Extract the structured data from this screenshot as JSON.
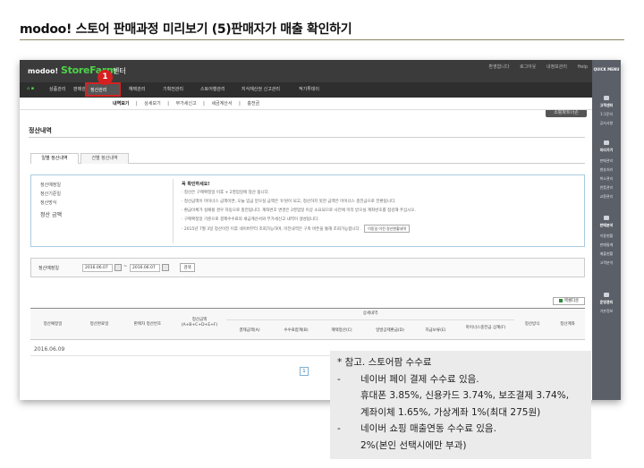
{
  "slide": {
    "title": "modoo! 스토어 판매과정 미리보기 (5)판매자가 매출 확인하기"
  },
  "header": {
    "modoo_logo": "modoo!",
    "store_logo": "StoreFarm",
    "center_label": "센터",
    "top_links": [
      "환영합니다 ",
      "로그아웃",
      "내정보관리",
      "Help"
    ]
  },
  "menu": {
    "items": [
      "상품관리",
      "판매관리",
      "정산관리",
      "혜택관리",
      "기획전관리",
      "스토어행관리",
      "지식재산권 신고관리",
      "적기투데이"
    ],
    "active": "정산관리",
    "right_button": "쇼핑파트너존",
    "badge": "1"
  },
  "submenu": {
    "items": [
      "내역보기",
      "상세보기",
      "부가세신고",
      "세금계산서",
      "충전금"
    ]
  },
  "right_panel": {
    "items": [
      "QUICK MENU",
      "고객센터",
      "1:1문의",
      "공지사항",
      "미리가기",
      "판매관리",
      "발송처리",
      "취소관리",
      "반품관리",
      "교환관리",
      "판매분석",
      "이용현황",
      "판매통계",
      "매출현황",
      "고객분석",
      "운영관리",
      "기본정보"
    ]
  },
  "page": {
    "heading": "정산내역",
    "tabs": [
      "일별 정산내역",
      "건별 정산내역"
    ],
    "active_tab": "일별 정산내역"
  },
  "info_box": {
    "labels": [
      "정산예정일",
      "정산기준일",
      "정산방식",
      "정산 금액"
    ],
    "lead": "꼭 확인하세요!",
    "notes": [
      "· 정산은 구매확정일 이후 + 2영업일에 정산 됩니다.",
      "· 정산금액이 마이너스 금액이면, 오늘 입금 받으실 금액은 '0'원이 되고, 정산하지 못한 금액은 마이너스 충전금으로 전환됩니다.",
      "· 환급이체가 실패될 경우 자동으로 충전됩니다. 계좌번호 변경은 2영업일 이상 소요되므로 사전에 미리 받으실 계좌번호를 점검해 주십시오.",
      "· 구매확정일 기준으로 결제수수료의 세금계산서와 부가세신고 내역이 생성됩니다.",
      "· 2015년 7월 3일 정산이전 이후 네이버부터 조회가능하며, 이전내역은 구축 버튼을 통해 조회가능합니다."
    ],
    "prev_button": "이동일 이전 정산현황내역"
  },
  "search": {
    "label": "정산예정일",
    "date_from": "2016.06.07",
    "date_to": "2016.06.07",
    "tilde": "~",
    "button": "검색"
  },
  "grid": {
    "excel_button": "엑셀다운",
    "group_header": "상세내역",
    "columns": [
      "정산예정일",
      "정산완료일",
      "판매자 정산번호",
      "정산금액\n(A+B+C+D+E+F)",
      "결제금액(A)",
      "수수료합계(B)",
      "혜택정산(C)",
      "일발공제환급(D)",
      "지급보류(E)",
      "마이너스충전금 상계(F)",
      "정산방식",
      "정산계좌"
    ],
    "rows": [
      {
        "date": "2016.06.09"
      }
    ],
    "page_number": "1"
  },
  "note": {
    "title": "* 참고. 스토어팜 수수료",
    "lines": [
      {
        "type": "bullet",
        "text": "네이버 페이 결제 수수료 있음."
      },
      {
        "type": "indent",
        "text": "휴대폰 3.85%, 신용카드 3.74%, 보조결제 3.74%,"
      },
      {
        "type": "indent",
        "text": "계좌이체 1.65%, 가상계좌 1%(최대 275원)"
      },
      {
        "type": "bullet",
        "text": "네이버 쇼핑 매출연동 수수료 있음."
      },
      {
        "type": "indent",
        "text": "2%(본인 선택시에만 부과)"
      }
    ],
    "dash": "-"
  }
}
